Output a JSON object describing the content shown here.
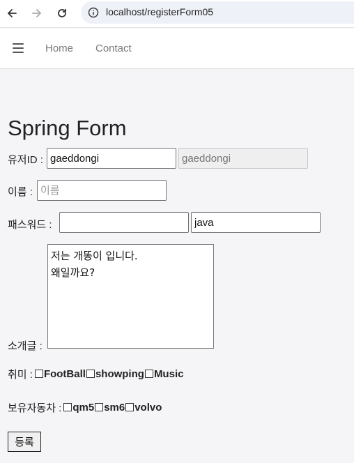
{
  "browser": {
    "url": "localhost/registerForm05"
  },
  "nav": {
    "links": [
      "Home",
      "Contact"
    ]
  },
  "form": {
    "title": "Spring Form",
    "userid": {
      "label": "유저ID :",
      "value": "gaeddongi",
      "readonly_value": "gaeddongi"
    },
    "name": {
      "label": "이름 :",
      "placeholder": "이름"
    },
    "password": {
      "label": "패스워드 :",
      "value": "",
      "text_value": "java"
    },
    "intro": {
      "label": "소개글 :",
      "line1": "저는 개똥이 입니다.",
      "line2": "왜일까요?"
    },
    "hobby": {
      "label": "취미 :",
      "options": [
        "FootBall",
        "showping",
        "Music"
      ]
    },
    "car": {
      "label": "보유자동차 :",
      "options": [
        "qm5",
        "sm6",
        "volvo"
      ]
    },
    "submit_label": "등록"
  }
}
